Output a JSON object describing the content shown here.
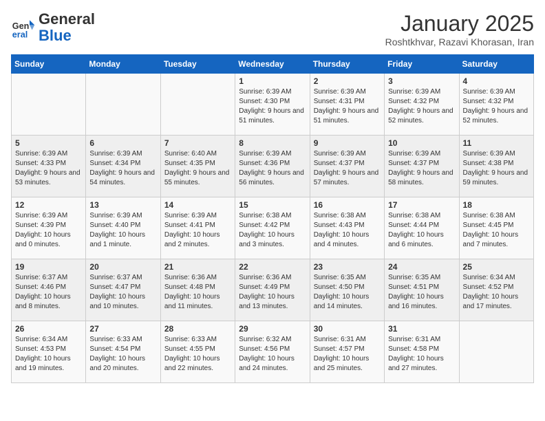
{
  "header": {
    "logo_line1": "General",
    "logo_line2": "Blue",
    "month_title": "January 2025",
    "subtitle": "Roshtkhvar, Razavi Khorasan, Iran"
  },
  "weekdays": [
    "Sunday",
    "Monday",
    "Tuesday",
    "Wednesday",
    "Thursday",
    "Friday",
    "Saturday"
  ],
  "weeks": [
    [
      {
        "day": "",
        "info": ""
      },
      {
        "day": "",
        "info": ""
      },
      {
        "day": "",
        "info": ""
      },
      {
        "day": "1",
        "info": "Sunrise: 6:39 AM\nSunset: 4:30 PM\nDaylight: 9 hours and 51 minutes."
      },
      {
        "day": "2",
        "info": "Sunrise: 6:39 AM\nSunset: 4:31 PM\nDaylight: 9 hours and 51 minutes."
      },
      {
        "day": "3",
        "info": "Sunrise: 6:39 AM\nSunset: 4:32 PM\nDaylight: 9 hours and 52 minutes."
      },
      {
        "day": "4",
        "info": "Sunrise: 6:39 AM\nSunset: 4:32 PM\nDaylight: 9 hours and 52 minutes."
      }
    ],
    [
      {
        "day": "5",
        "info": "Sunrise: 6:39 AM\nSunset: 4:33 PM\nDaylight: 9 hours and 53 minutes."
      },
      {
        "day": "6",
        "info": "Sunrise: 6:39 AM\nSunset: 4:34 PM\nDaylight: 9 hours and 54 minutes."
      },
      {
        "day": "7",
        "info": "Sunrise: 6:40 AM\nSunset: 4:35 PM\nDaylight: 9 hours and 55 minutes."
      },
      {
        "day": "8",
        "info": "Sunrise: 6:39 AM\nSunset: 4:36 PM\nDaylight: 9 hours and 56 minutes."
      },
      {
        "day": "9",
        "info": "Sunrise: 6:39 AM\nSunset: 4:37 PM\nDaylight: 9 hours and 57 minutes."
      },
      {
        "day": "10",
        "info": "Sunrise: 6:39 AM\nSunset: 4:37 PM\nDaylight: 9 hours and 58 minutes."
      },
      {
        "day": "11",
        "info": "Sunrise: 6:39 AM\nSunset: 4:38 PM\nDaylight: 9 hours and 59 minutes."
      }
    ],
    [
      {
        "day": "12",
        "info": "Sunrise: 6:39 AM\nSunset: 4:39 PM\nDaylight: 10 hours and 0 minutes."
      },
      {
        "day": "13",
        "info": "Sunrise: 6:39 AM\nSunset: 4:40 PM\nDaylight: 10 hours and 1 minute."
      },
      {
        "day": "14",
        "info": "Sunrise: 6:39 AM\nSunset: 4:41 PM\nDaylight: 10 hours and 2 minutes."
      },
      {
        "day": "15",
        "info": "Sunrise: 6:38 AM\nSunset: 4:42 PM\nDaylight: 10 hours and 3 minutes."
      },
      {
        "day": "16",
        "info": "Sunrise: 6:38 AM\nSunset: 4:43 PM\nDaylight: 10 hours and 4 minutes."
      },
      {
        "day": "17",
        "info": "Sunrise: 6:38 AM\nSunset: 4:44 PM\nDaylight: 10 hours and 6 minutes."
      },
      {
        "day": "18",
        "info": "Sunrise: 6:38 AM\nSunset: 4:45 PM\nDaylight: 10 hours and 7 minutes."
      }
    ],
    [
      {
        "day": "19",
        "info": "Sunrise: 6:37 AM\nSunset: 4:46 PM\nDaylight: 10 hours and 8 minutes."
      },
      {
        "day": "20",
        "info": "Sunrise: 6:37 AM\nSunset: 4:47 PM\nDaylight: 10 hours and 10 minutes."
      },
      {
        "day": "21",
        "info": "Sunrise: 6:36 AM\nSunset: 4:48 PM\nDaylight: 10 hours and 11 minutes."
      },
      {
        "day": "22",
        "info": "Sunrise: 6:36 AM\nSunset: 4:49 PM\nDaylight: 10 hours and 13 minutes."
      },
      {
        "day": "23",
        "info": "Sunrise: 6:35 AM\nSunset: 4:50 PM\nDaylight: 10 hours and 14 minutes."
      },
      {
        "day": "24",
        "info": "Sunrise: 6:35 AM\nSunset: 4:51 PM\nDaylight: 10 hours and 16 minutes."
      },
      {
        "day": "25",
        "info": "Sunrise: 6:34 AM\nSunset: 4:52 PM\nDaylight: 10 hours and 17 minutes."
      }
    ],
    [
      {
        "day": "26",
        "info": "Sunrise: 6:34 AM\nSunset: 4:53 PM\nDaylight: 10 hours and 19 minutes."
      },
      {
        "day": "27",
        "info": "Sunrise: 6:33 AM\nSunset: 4:54 PM\nDaylight: 10 hours and 20 minutes."
      },
      {
        "day": "28",
        "info": "Sunrise: 6:33 AM\nSunset: 4:55 PM\nDaylight: 10 hours and 22 minutes."
      },
      {
        "day": "29",
        "info": "Sunrise: 6:32 AM\nSunset: 4:56 PM\nDaylight: 10 hours and 24 minutes."
      },
      {
        "day": "30",
        "info": "Sunrise: 6:31 AM\nSunset: 4:57 PM\nDaylight: 10 hours and 25 minutes."
      },
      {
        "day": "31",
        "info": "Sunrise: 6:31 AM\nSunset: 4:58 PM\nDaylight: 10 hours and 27 minutes."
      },
      {
        "day": "",
        "info": ""
      }
    ]
  ]
}
